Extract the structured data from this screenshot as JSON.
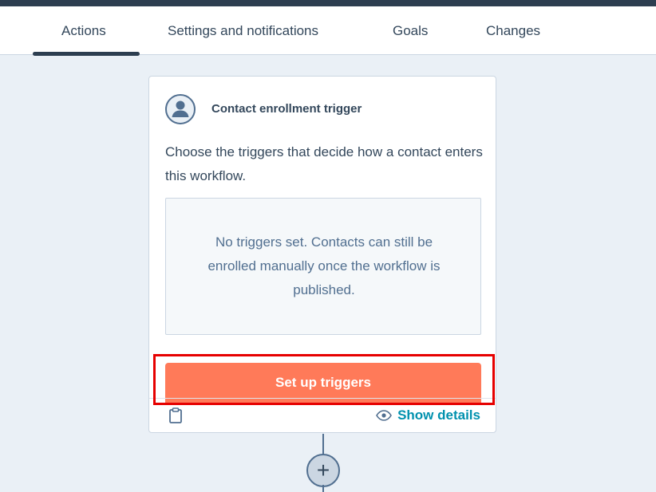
{
  "tabs": [
    {
      "label": "Actions",
      "active": true
    },
    {
      "label": "Settings and notifications",
      "active": false
    },
    {
      "label": "Goals",
      "active": false
    },
    {
      "label": "Changes",
      "active": false
    }
  ],
  "trigger_card": {
    "title": "Contact enrollment trigger",
    "icon": "contact-avatar-icon",
    "description": "Choose the triggers that decide how a contact enters this workflow.",
    "empty_state": "No triggers set. Contacts can still be enrolled manually once the workflow is published.",
    "primary_button": "Set up triggers",
    "show_details_label": "Show details"
  },
  "add_action": {
    "symbol": "+"
  },
  "colors": {
    "background": "#eaf0f6",
    "primary_button": "#ff7a59",
    "link": "#0091ae",
    "highlight": "#e60000",
    "nav_dark": "#2d3e50"
  }
}
